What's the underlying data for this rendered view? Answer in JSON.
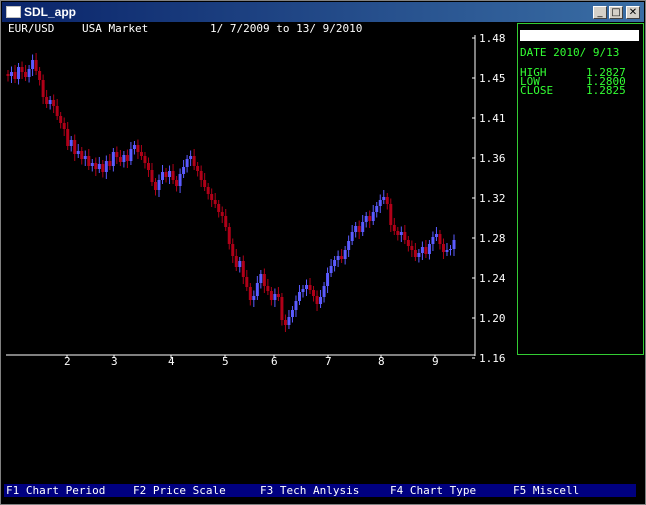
{
  "window": {
    "title": "SDL_app"
  },
  "chart_header": {
    "symbol": "EUR/USD",
    "market": "USA Market",
    "range": "1/ 7/2009 to 13/ 9/2010"
  },
  "info_panel": {
    "date_label": "DATE",
    "date_value": "2010/ 9/13",
    "high_label": "HIGH",
    "high_value": "1.2827",
    "low_label": "LOW",
    "low_value": "1.2800",
    "close_label": "CLOSE",
    "close_value": "1.2825"
  },
  "function_keys": [
    {
      "key": "F1",
      "label": "Chart Period"
    },
    {
      "key": "F2",
      "label": "Price Scale"
    },
    {
      "key": "F3",
      "label": "Tech Anlysis"
    },
    {
      "key": "F4",
      "label": "Chart Type"
    },
    {
      "key": "F5",
      "label": "Miscell"
    }
  ],
  "colors": {
    "up": "#5b5bff",
    "down": "#b00018",
    "info_text": "#33ff33",
    "fkey_bar": "#000080"
  },
  "chart_data": {
    "type": "candlestick",
    "y_ticks": [
      "1.48",
      "1.45",
      "1.41",
      "1.36",
      "1.32",
      "1.28",
      "1.24",
      "1.20",
      "1.16"
    ],
    "x_ticks": [
      "2",
      "3",
      "4",
      "5",
      "6",
      "7",
      "8",
      "9"
    ],
    "ylim": [
      1.16,
      1.48
    ],
    "close": [
      1.442,
      1.446,
      1.439,
      1.451,
      1.446,
      1.441,
      1.449,
      1.458,
      1.447,
      1.438,
      1.421,
      1.414,
      1.418,
      1.412,
      1.402,
      1.395,
      1.389,
      1.372,
      1.378,
      1.364,
      1.367,
      1.359,
      1.362,
      1.352,
      1.355,
      1.349,
      1.354,
      1.346,
      1.357,
      1.352,
      1.366,
      1.361,
      1.356,
      1.363,
      1.357,
      1.369,
      1.373,
      1.366,
      1.362,
      1.355,
      1.348,
      1.336,
      1.328,
      1.338,
      1.346,
      1.341,
      1.347,
      1.338,
      1.332,
      1.344,
      1.351,
      1.359,
      1.362,
      1.352,
      1.347,
      1.338,
      1.331,
      1.324,
      1.318,
      1.314,
      1.306,
      1.302,
      1.291,
      1.274,
      1.262,
      1.251,
      1.257,
      1.241,
      1.231,
      1.218,
      1.222,
      1.235,
      1.244,
      1.232,
      1.227,
      1.218,
      1.224,
      1.221,
      1.198,
      1.193,
      1.201,
      1.208,
      1.217,
      1.226,
      1.229,
      1.233,
      1.228,
      1.222,
      1.214,
      1.221,
      1.232,
      1.245,
      1.252,
      1.258,
      1.262,
      1.259,
      1.268,
      1.277,
      1.286,
      1.292,
      1.286,
      1.296,
      1.302,
      1.297,
      1.306,
      1.312,
      1.318,
      1.321,
      1.314,
      1.293,
      1.287,
      1.283,
      1.286,
      1.278,
      1.272,
      1.268,
      1.261,
      1.265,
      1.271,
      1.264,
      1.274,
      1.281,
      1.284,
      1.274,
      1.266,
      1.268,
      1.269,
      1.278
    ]
  }
}
